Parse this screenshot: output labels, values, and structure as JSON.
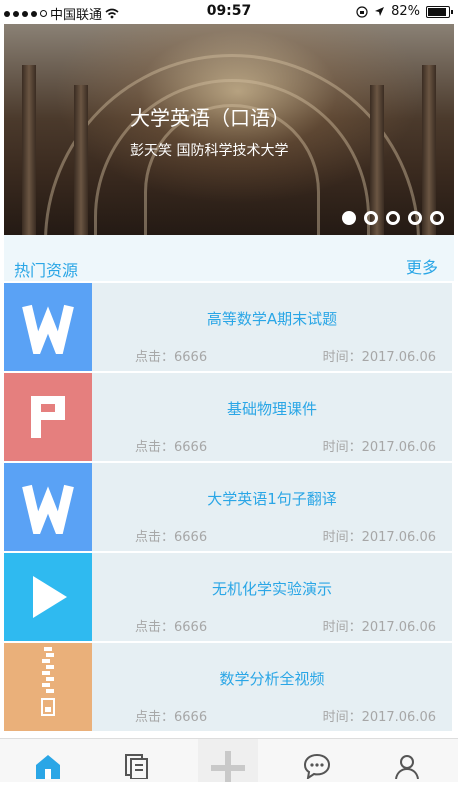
{
  "status_bar": {
    "carrier": "中国联通",
    "time": "09:57",
    "battery": "82%"
  },
  "banner": {
    "title": "大学英语（口语）",
    "subtitle": "彭天笑 国防科学技术大学",
    "slides": 5,
    "active_slide": 1
  },
  "section": {
    "title": "热门资源",
    "more": "更多"
  },
  "resources": [
    {
      "icon": "word-doc-icon",
      "color": "#5aa2f5",
      "name": "高等数学A期末试题",
      "clicks": "点击：6666",
      "time": "时间：2017.06.06"
    },
    {
      "icon": "ppt-doc-icon",
      "color": "#e57f7e",
      "name": "基础物理课件",
      "clicks": "点击：6666",
      "time": "时间：2017.06.06"
    },
    {
      "icon": "word-doc-icon",
      "color": "#5aa2f5",
      "name": "大学英语1句子翻译",
      "clicks": "点击：6666",
      "time": "时间：2017.06.06"
    },
    {
      "icon": "video-play-icon",
      "color": "#2fbaf0",
      "name": "无机化学实验演示",
      "clicks": "点击：6666",
      "time": "时间：2017.06.06"
    },
    {
      "icon": "zip-archive-icon",
      "color": "#eab07a",
      "name": "数学分析全视频",
      "clicks": "点击：6666",
      "time": "时间：2017.06.06"
    }
  ],
  "tab_bar": {
    "items": [
      "home-icon",
      "documents-icon",
      "add-icon",
      "chat-icon",
      "profile-icon"
    ],
    "active": "home-icon",
    "accent": "#2aa6e6"
  }
}
